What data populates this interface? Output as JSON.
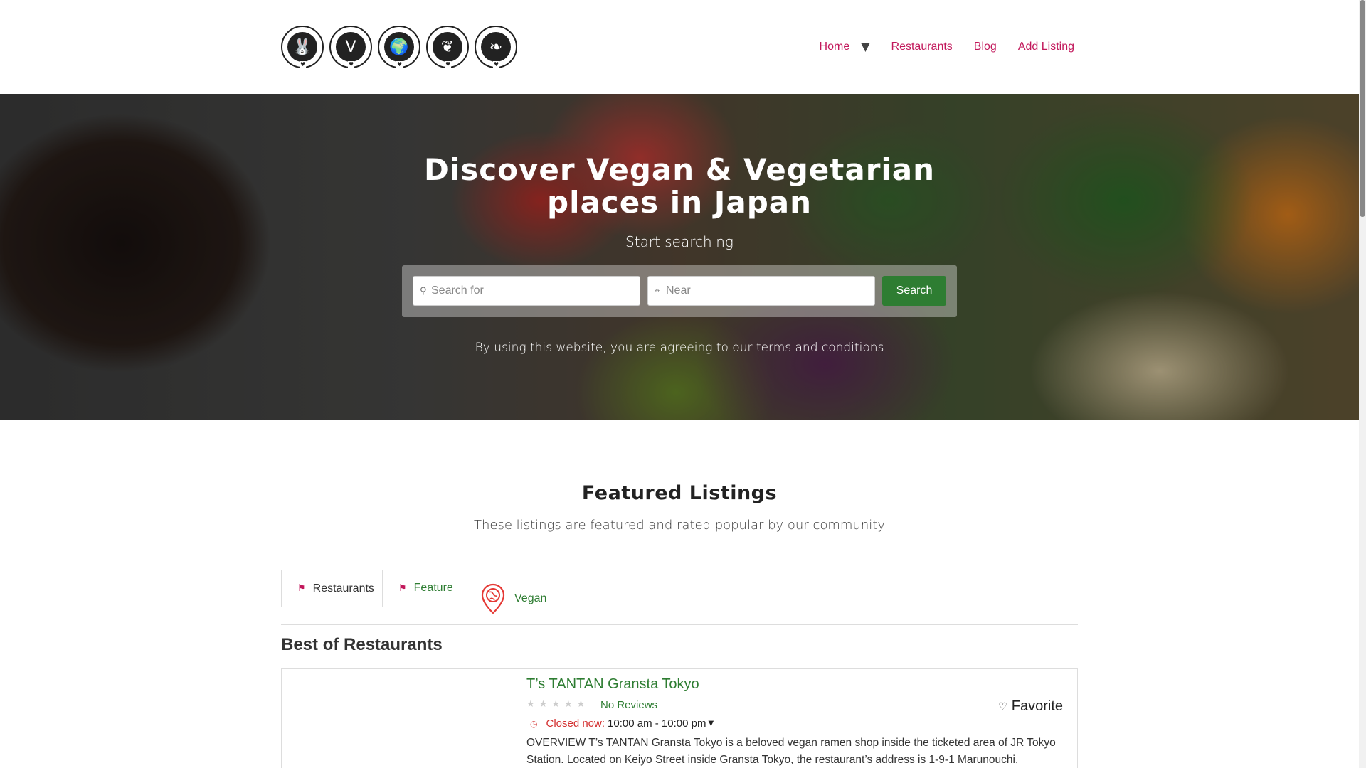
{
  "header": {
    "badges": [
      {
        "name": "cruelty-free-badge",
        "glyph": "🐰"
      },
      {
        "name": "vegan-badge",
        "glyph": "V"
      },
      {
        "name": "eco-friendly-badge",
        "glyph": "🌍"
      },
      {
        "name": "organic-badge",
        "glyph": "❦"
      },
      {
        "name": "natural-badge",
        "glyph": "❧"
      }
    ],
    "nav": {
      "home": "Home",
      "home_caret": "▼",
      "restaurants": "Restaurants",
      "blog": "Blog",
      "add_listing": "Add Listing"
    }
  },
  "hero": {
    "title": "Discover Vegan & Vegetarian places in Japan",
    "subtitle": "Start searching",
    "search_for_placeholder": "Search for",
    "near_placeholder": "Near",
    "search_button": "Search",
    "terms": "By using this website, you are agreeing to our terms and conditions"
  },
  "featured": {
    "title": "Featured Listings",
    "subtitle": "These listings are featured and rated popular by our community",
    "tabs": {
      "restaurants": "Restaurants",
      "feature": "Feature",
      "vegan": "Vegan"
    },
    "section_heading": "Best of Restaurants"
  },
  "listing": {
    "title": "T’s TANTAN Gransta Tokyo",
    "rating": 0,
    "reviews": "No Reviews",
    "favorite": "Favorite",
    "status": "Closed now:",
    "hours": "10:00 am - 10:00 pm",
    "overview": "OVERVIEW T’s TANTAN Gransta Tokyo is a beloved vegan ramen shop inside the ticketed area of JR Tokyo Station. Located on Keiyo Street inside Gransta Tokyo, the restaurant’s address is 1-9-1 Marunouchi,"
  },
  "colors": {
    "nav_link": "#c2185b",
    "accent_green": "#2e7d32",
    "closed_red": "#d32f2f"
  }
}
